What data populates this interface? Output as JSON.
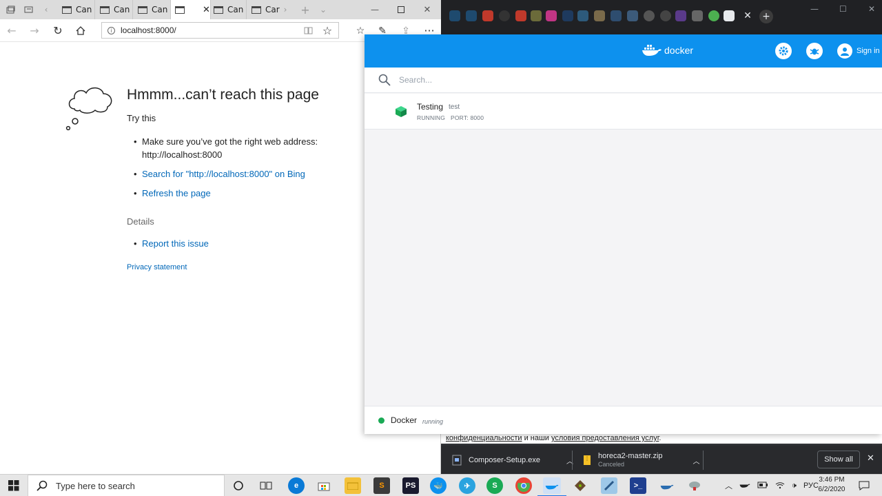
{
  "edge": {
    "tabs": [
      {
        "label": "Can"
      },
      {
        "label": "Can"
      },
      {
        "label": "Can"
      },
      {
        "label": "",
        "active": true
      },
      {
        "label": "Can"
      },
      {
        "label": "Car"
      }
    ],
    "address": "localhost:8000/",
    "error": {
      "title": "Hmmm...can’t reach this page",
      "try_this": "Try this",
      "bullet_1": "Make sure you’ve got the right web address: http://localhost:8000",
      "bullet_2": "Search for \"http://localhost:8000\" on Bing",
      "bullet_3": "Refresh the page",
      "details": "Details",
      "report": "Report this issue",
      "privacy": "Privacy statement"
    }
  },
  "chrome": {
    "footer_text_link_1": "конфиденциальности",
    "footer_text_mid": " и наши ",
    "footer_text_link_2": "условия предоставления услуг",
    "footer_text_end": ".",
    "downloads": [
      {
        "name": "Composer-Setup.exe",
        "status": ""
      },
      {
        "name": "horeca2-master.zip",
        "status": "Canceled"
      }
    ],
    "show_all": "Show all"
  },
  "docker": {
    "logo_text": "docker",
    "sign_in": "Sign in",
    "search_placeholder": "Search...",
    "container": {
      "name": "Testing",
      "image": "test",
      "status": "RUNNING",
      "port": "PORT: 8000"
    },
    "engine_label": "Docker",
    "engine_status": "running",
    "colors": {
      "header": "#0d91ee",
      "running": "#1aaa55"
    }
  },
  "taskbar": {
    "search_placeholder": "Type here to search",
    "language": "РУС",
    "time": "3:46 PM",
    "date": "6/2/2020"
  }
}
